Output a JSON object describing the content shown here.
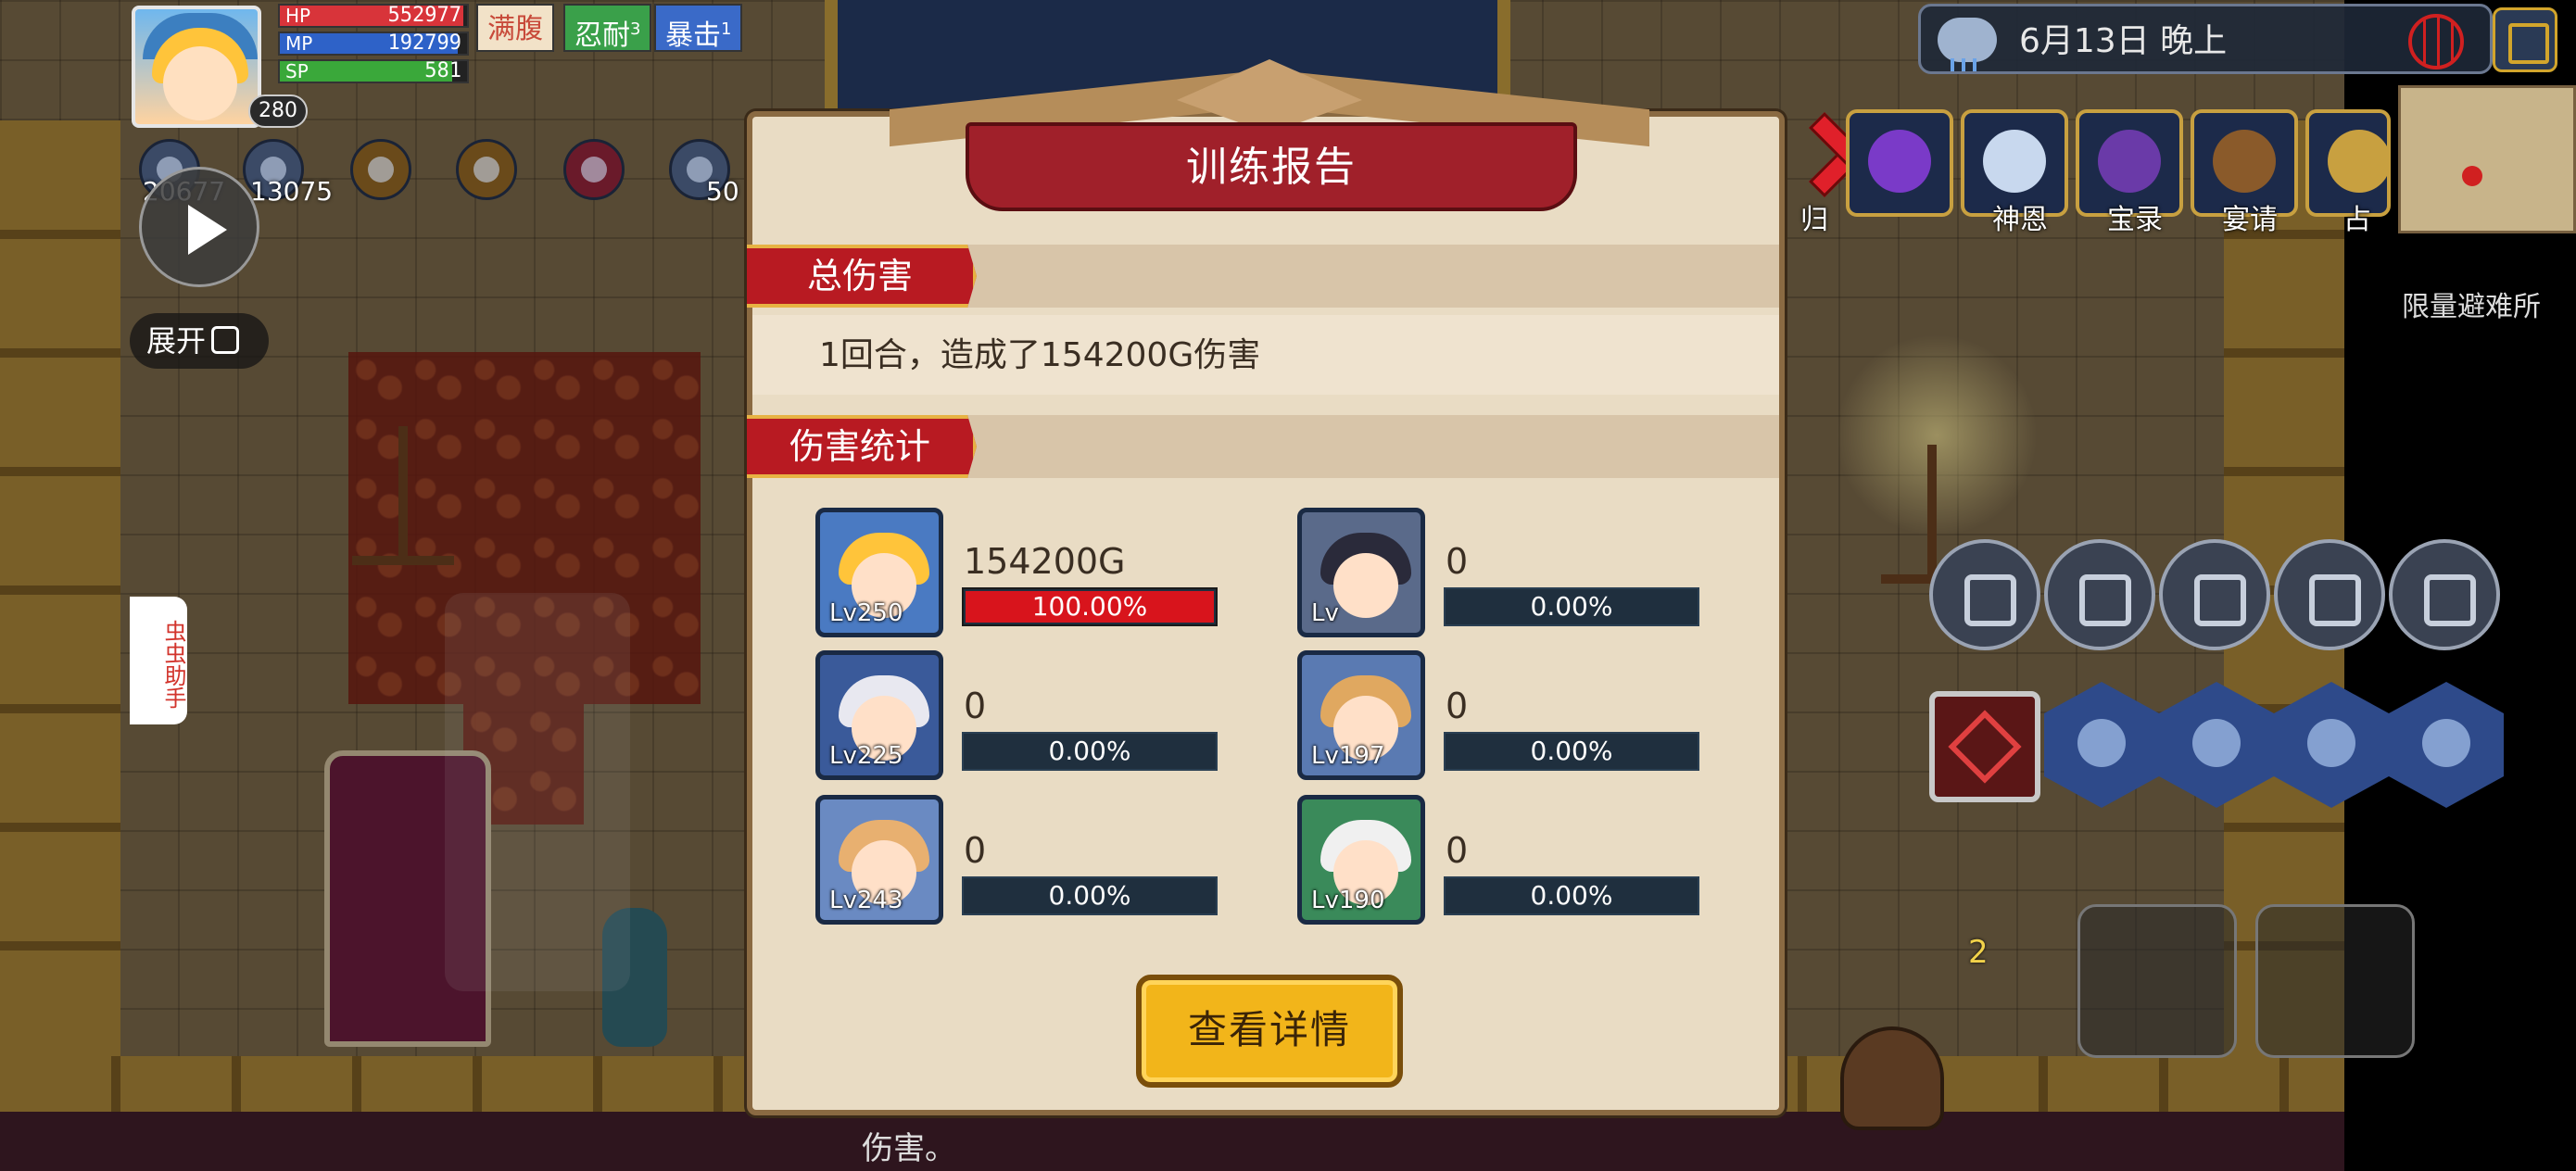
{
  "player": {
    "hp_label": "HP",
    "hp_value": "552977",
    "hp_fraction": 0.98,
    "mp_label": "MP",
    "mp_value": "192799",
    "mp_fraction": 0.95,
    "sp_label": "SP",
    "sp_value": "581",
    "sp_fraction": 0.92,
    "level": "280"
  },
  "status_tags": [
    {
      "label": "满腹",
      "sup": "",
      "color": "#c84a3a"
    },
    {
      "label": "忍耐",
      "sup": "3",
      "color": "#3aa04a"
    },
    {
      "label": "暴击",
      "sup": "1",
      "color": "#3a6ac8"
    }
  ],
  "buff_counts": [
    "20677",
    "13075",
    "50"
  ],
  "overlay": {
    "expand_label": "展开",
    "helper_label": "虫虫助手"
  },
  "world": {
    "date": "6月13日",
    "time_of_day": "晚上",
    "weather_icon": "rain-cloud-icon",
    "menu": [
      {
        "label": "归",
        "icon": "return-icon"
      },
      {
        "label": "神恩",
        "icon": "altar-icon"
      },
      {
        "label": "宝录",
        "icon": "treasure-book-icon"
      },
      {
        "label": "宴请",
        "icon": "banquet-table-icon"
      },
      {
        "label": "占",
        "icon": "divination-icon"
      }
    ],
    "minimap_label": "限量避难所",
    "bottom_hint": "伤害。",
    "ammo_count": "2"
  },
  "dialog": {
    "title": "训练报告",
    "total_damage_label": "总伤害",
    "summary": "1回合，造成了154200G伤害",
    "stats_label": "伤害统计",
    "detail_button": "查看详情",
    "members": [
      {
        "level": "Lv250",
        "damage": "154200G",
        "percent": "100.00%",
        "share": 1.0,
        "hair": "#ffc43a",
        "bg": "#4a7ac2"
      },
      {
        "level": "Lv",
        "damage": "0",
        "percent": "0.00%",
        "share": 0.0,
        "hair": "#2a2a3a",
        "bg": "#5a6a8a"
      },
      {
        "level": "Lv225",
        "damage": "0",
        "percent": "0.00%",
        "share": 0.0,
        "hair": "#e8e8f0",
        "bg": "#3a5a9a"
      },
      {
        "level": "Lv197",
        "damage": "0",
        "percent": "0.00%",
        "share": 0.0,
        "hair": "#e0a860",
        "bg": "#5a7ab2"
      },
      {
        "level": "Lv243",
        "damage": "0",
        "percent": "0.00%",
        "share": 0.0,
        "hair": "#e8b070",
        "bg": "#6a8ac2"
      },
      {
        "level": "Lv190",
        "damage": "0",
        "percent": "0.00%",
        "share": 0.0,
        "hair": "#f0f0f0",
        "bg": "#3a8a5a"
      }
    ]
  }
}
